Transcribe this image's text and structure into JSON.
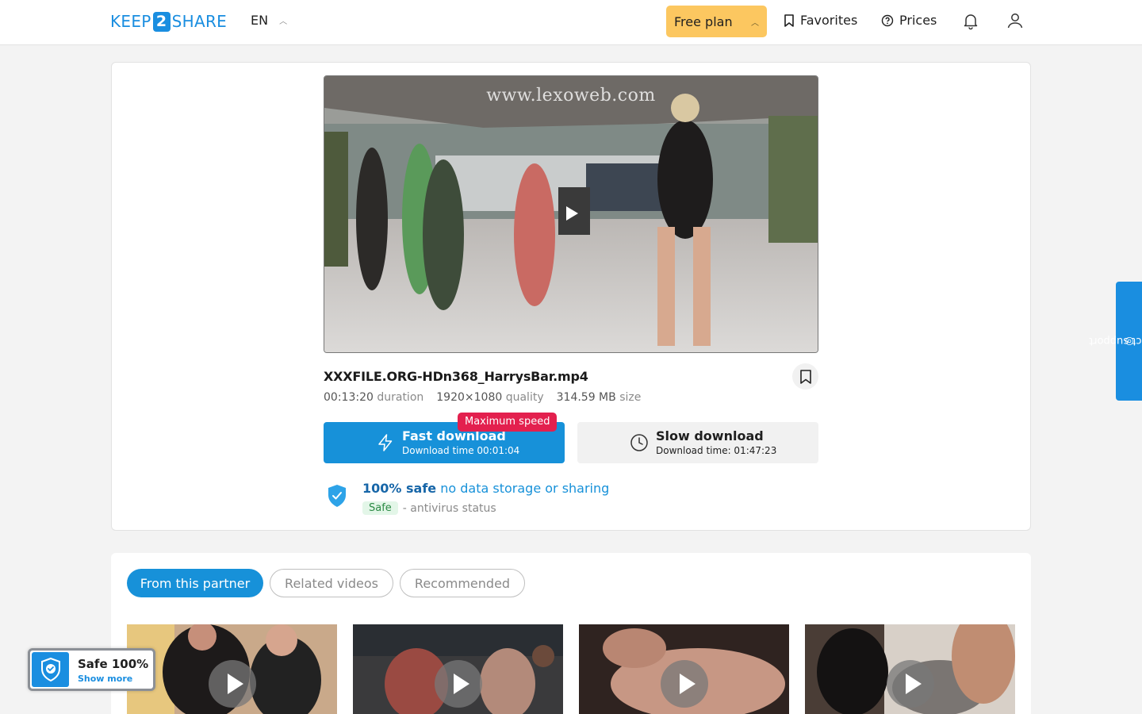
{
  "header": {
    "logo_left": "KEEP",
    "logo_mid": "2",
    "logo_right": "SHARE",
    "language": "EN",
    "plan_button": "Free plan",
    "favorites": "Favorites",
    "prices": "Prices"
  },
  "video": {
    "watermark": "www.lexoweb.com",
    "file_name": "XXXFILE.ORG-HDn368_HarrysBar.mp4",
    "duration_value": "00:13:20",
    "duration_label": "duration",
    "quality_value": "1920×1080",
    "quality_label": "quality",
    "size_value": "314.59 MB",
    "size_label": "size"
  },
  "download": {
    "fast_title": "Fast download",
    "fast_time": "Download time 00:01:04",
    "max_speed_badge": "Maximum speed",
    "slow_title": "Slow download",
    "slow_time": "Download time: 01:47:23"
  },
  "safety": {
    "safe_bold": "100% safe",
    "safe_text": "no data storage or sharing",
    "av_badge": "Safe",
    "av_text": "- antivirus status"
  },
  "contact_support": "contact support",
  "tabs": [
    "From this partner",
    "Related videos",
    "Recommended"
  ],
  "safe_widget": {
    "title": "Safe 100%",
    "link": "Show more"
  },
  "colors": {
    "brand_blue": "#1791d9",
    "plan_yellow": "#fcc760",
    "badge_red": "#e3204e"
  }
}
